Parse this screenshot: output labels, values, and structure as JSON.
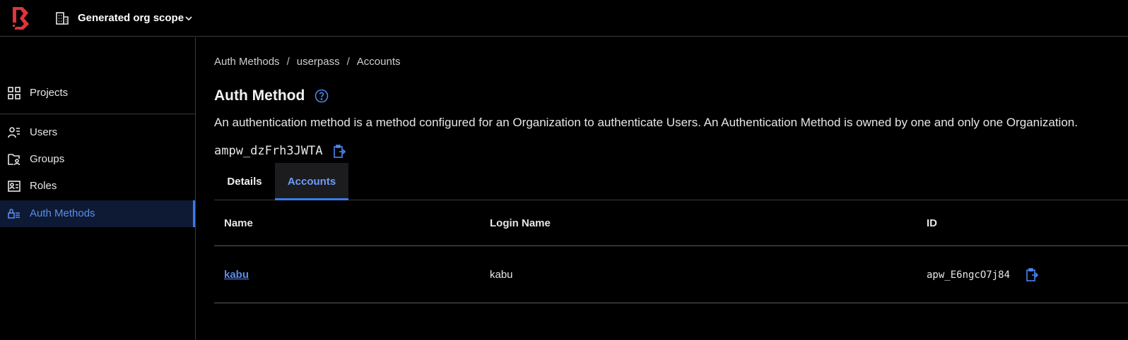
{
  "header": {
    "org_scope": "Generated org scope"
  },
  "sidebar": {
    "items": [
      {
        "label": "Projects"
      },
      {
        "label": "Users"
      },
      {
        "label": "Groups"
      },
      {
        "label": "Roles"
      },
      {
        "label": "Auth Methods",
        "active": true
      }
    ]
  },
  "breadcrumb": [
    "Auth Methods",
    "userpass",
    "Accounts"
  ],
  "page": {
    "title": "Auth Method",
    "description": "An authentication method is a method configured for an Organization to authenticate Users. An Authentication Method is owned by one and only one Organization.",
    "resource_id": "ampw_dzFrh3JWTA"
  },
  "tabs": [
    {
      "label": "Details"
    },
    {
      "label": "Accounts",
      "active": true
    }
  ],
  "table": {
    "columns": [
      "Name",
      "Login Name",
      "ID"
    ],
    "rows": [
      {
        "name": "kabu",
        "login_name": "kabu",
        "id": "apw_E6ngcO7j84"
      }
    ]
  },
  "colors": {
    "accent": "#3b7bea",
    "link": "#5a8dee",
    "brand_red": "#e0343a",
    "background": "#000000"
  }
}
